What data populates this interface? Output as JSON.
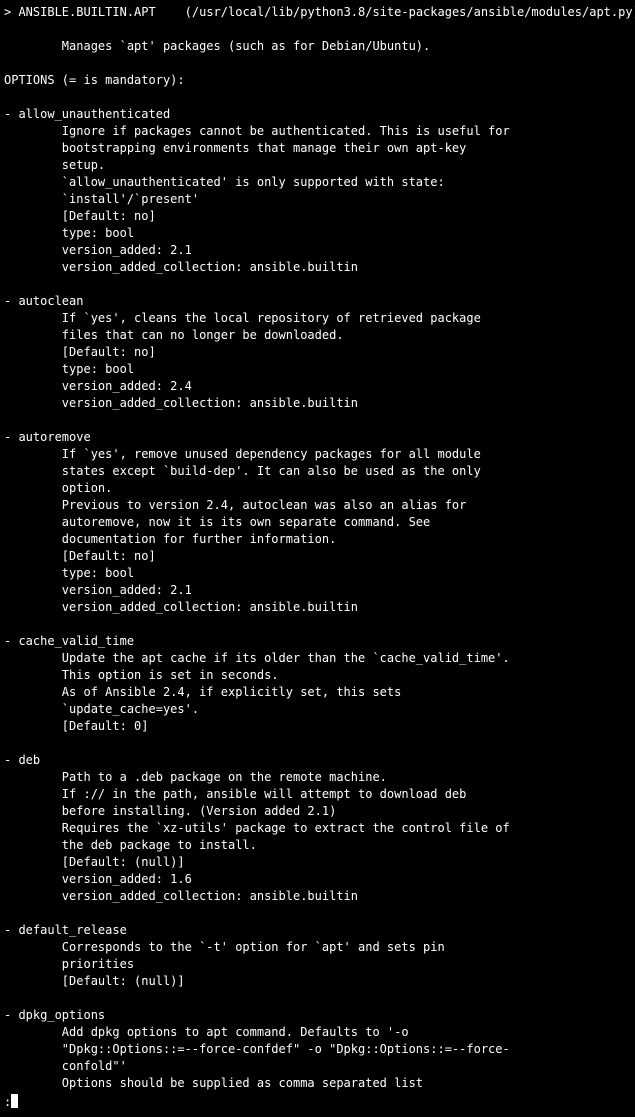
{
  "header": {
    "prefix": "> ",
    "module": "ANSIBLE.BUILTIN.APT",
    "gap": "    ",
    "path": "(/usr/local/lib/python3.8/site-packages/ansible/modules/apt.py)"
  },
  "summary": {
    "indent": "        ",
    "text": "Manages `apt' packages (such as for Debian/Ubuntu)."
  },
  "options_header": "OPTIONS (= is mandatory):",
  "option_bullet": "- ",
  "detail_indent": "        ",
  "options": [
    {
      "name": "allow_unauthenticated",
      "lines": [
        "Ignore if packages cannot be authenticated. This is useful for",
        "bootstrapping environments that manage their own apt-key",
        "setup.",
        "`allow_unauthenticated' is only supported with state:",
        "`install'/`present'",
        "[Default: no]",
        "type: bool",
        "version_added: 2.1",
        "version_added_collection: ansible.builtin"
      ]
    },
    {
      "name": "autoclean",
      "lines": [
        "If `yes', cleans the local repository of retrieved package",
        "files that can no longer be downloaded.",
        "[Default: no]",
        "type: bool",
        "version_added: 2.4",
        "version_added_collection: ansible.builtin"
      ]
    },
    {
      "name": "autoremove",
      "lines": [
        "If `yes', remove unused dependency packages for all module",
        "states except `build-dep'. It can also be used as the only",
        "option.",
        "Previous to version 2.4, autoclean was also an alias for",
        "autoremove, now it is its own separate command. See",
        "documentation for further information.",
        "[Default: no]",
        "type: bool",
        "version_added: 2.1",
        "version_added_collection: ansible.builtin"
      ]
    },
    {
      "name": "cache_valid_time",
      "lines": [
        "Update the apt cache if its older than the `cache_valid_time'.",
        "This option is set in seconds.",
        "As of Ansible 2.4, if explicitly set, this sets",
        "`update_cache=yes'.",
        "[Default: 0]"
      ]
    },
    {
      "name": "deb",
      "lines": [
        "Path to a .deb package on the remote machine.",
        "If :// in the path, ansible will attempt to download deb",
        "before installing. (Version added 2.1)",
        "Requires the `xz-utils' package to extract the control file of",
        "the deb package to install.",
        "[Default: (null)]",
        "version_added: 1.6",
        "version_added_collection: ansible.builtin"
      ]
    },
    {
      "name": "default_release",
      "lines": [
        "Corresponds to the `-t' option for `apt' and sets pin",
        "priorities",
        "[Default: (null)]"
      ]
    },
    {
      "name": "dpkg_options",
      "lines": [
        "Add dpkg options to apt command. Defaults to '-o",
        "\"Dpkg::Options::=--force-confdef\" -o \"Dpkg::Options::=--force-",
        "confold\"'",
        "Options should be supplied as comma separated list"
      ]
    }
  ],
  "pager_prompt": ":"
}
